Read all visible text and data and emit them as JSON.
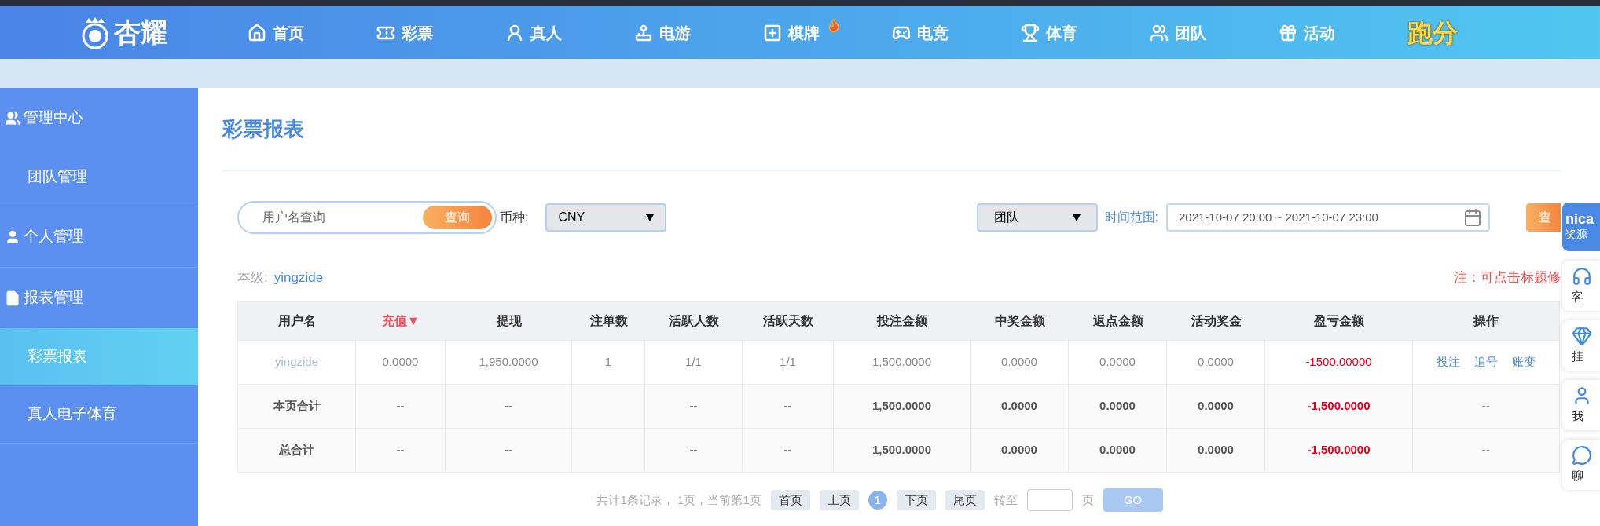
{
  "nav": {
    "logo_text": "杏耀",
    "items": [
      {
        "label": "首页",
        "kind": "link",
        "badge": false
      },
      {
        "label": "彩票",
        "kind": "link",
        "badge": false
      },
      {
        "label": "真人",
        "kind": "link",
        "badge": false
      },
      {
        "label": "电游",
        "kind": "link",
        "badge": false
      },
      {
        "label": "棋牌",
        "kind": "link",
        "badge": true
      },
      {
        "label": "电竞",
        "kind": "link",
        "badge": false
      },
      {
        "label": "体育",
        "kind": "link",
        "badge": false
      },
      {
        "label": "团队",
        "kind": "link",
        "badge": false
      },
      {
        "label": "活动",
        "kind": "link",
        "badge": false
      },
      {
        "label": "跑分",
        "kind": "highlight",
        "badge": false
      }
    ]
  },
  "sidebar": {
    "groups": [
      {
        "label": "管理中心",
        "children": [
          {
            "label": "团队管理",
            "selected": false
          }
        ]
      },
      {
        "label": "个人管理"
      },
      {
        "label": "报表管理",
        "children": [
          {
            "label": "彩票报表",
            "selected": true
          },
          {
            "label": "真人电子体育",
            "selected": false
          }
        ]
      }
    ]
  },
  "page_title": "彩票报表",
  "filters": {
    "search_placeholder": "用户名查询",
    "search_button": "查询",
    "currency_label": "币种:",
    "currency_value": "CNY",
    "scope_value": "团队",
    "time_label": "时间范围:",
    "time_value": "2021-10-07 20:00 ~ 2021-10-07 23:00",
    "query_button": "查"
  },
  "level": {
    "label": "本级:",
    "user": "yingzide"
  },
  "note": "注：可点击标题修",
  "table": {
    "columns": [
      {
        "label": "用户名",
        "sorted": false
      },
      {
        "label": "充值▼",
        "sorted": true
      },
      {
        "label": "提现",
        "sorted": false
      },
      {
        "label": "注单数",
        "sorted": false
      },
      {
        "label": "活跃人数",
        "sorted": false
      },
      {
        "label": "活跃天数",
        "sorted": false
      },
      {
        "label": "投注金额",
        "sorted": false
      },
      {
        "label": "中奖金额",
        "sorted": false
      },
      {
        "label": "返点金额",
        "sorted": false
      },
      {
        "label": "活动奖金",
        "sorted": false
      },
      {
        "label": "盈亏金额",
        "sorted": false
      },
      {
        "label": "操作",
        "sorted": false
      }
    ],
    "rows": [
      {
        "kind": "detail",
        "cells": [
          "yingzide",
          "0.0000",
          "1,950.0000",
          "1",
          "1/1",
          "1/1",
          "1,500.0000",
          "0.0000",
          "0.0000",
          "0.0000",
          "-1500.00000"
        ],
        "actions": [
          "投注",
          "追号",
          "账变"
        ]
      },
      {
        "kind": "total",
        "cells": [
          "本页合计",
          "--",
          "--",
          "",
          "--",
          "--",
          "1,500.0000",
          "0.0000",
          "0.0000",
          "0.0000",
          "-1,500.0000"
        ],
        "actions": [
          "--"
        ]
      },
      {
        "kind": "total",
        "cells": [
          "总合计",
          "--",
          "--",
          "",
          "--",
          "--",
          "1,500.0000",
          "0.0000",
          "0.0000",
          "0.0000",
          "-1,500.0000"
        ],
        "actions": [
          "--"
        ]
      }
    ]
  },
  "pagination": {
    "summary": "共计1条记录， 1页，当前第1页",
    "buttons": [
      {
        "label": "首页",
        "selected": false
      },
      {
        "label": "上页",
        "selected": false
      },
      {
        "label": "1",
        "selected": true
      },
      {
        "label": "下页",
        "selected": false
      },
      {
        "label": "尾页",
        "selected": false
      }
    ],
    "goto_label": "转至",
    "unit": "页",
    "go": "GO"
  },
  "float_panel": {
    "promo": {
      "brand": "nica",
      "label": "奖源"
    },
    "items": [
      {
        "label": "客"
      },
      {
        "label": "挂"
      },
      {
        "label": "我"
      },
      {
        "label": "聊"
      }
    ]
  }
}
